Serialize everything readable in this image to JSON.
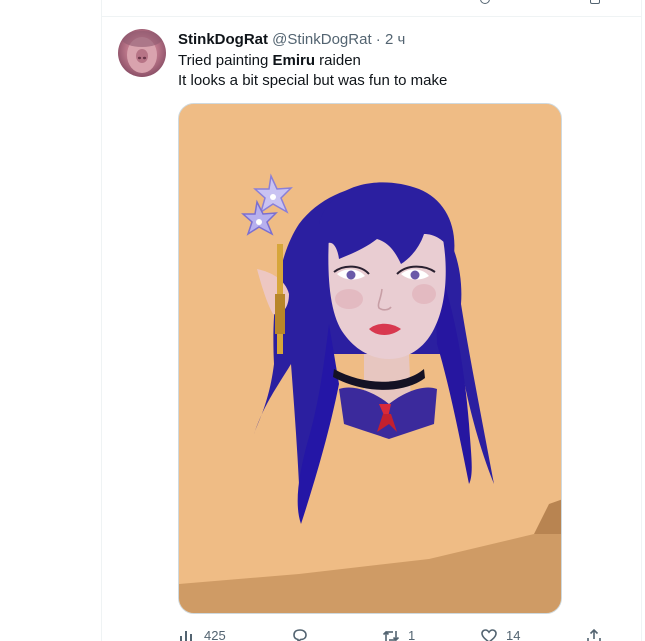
{
  "tweet": {
    "display_name": "StinkDogRat",
    "handle": "@StinkDogRat",
    "separator": "·",
    "time": "2 ч",
    "line1_prefix": "Tried painting ",
    "line1_bold": "Emiru",
    "line1_suffix": " raiden",
    "line2": "It looks a bit special but was fun to make"
  },
  "actions": {
    "views": "425",
    "replies": "",
    "retweets": "1",
    "likes": "14"
  },
  "icons": {
    "views": "analytics-icon",
    "reply": "reply-icon",
    "retweet": "retweet-icon",
    "like": "heart-icon",
    "share": "share-icon"
  },
  "colors": {
    "text_primary": "#0f1419",
    "text_secondary": "#536471",
    "border": "#eff3f4",
    "painting_background": "#efbc85",
    "hair": "#2b1fa0"
  }
}
